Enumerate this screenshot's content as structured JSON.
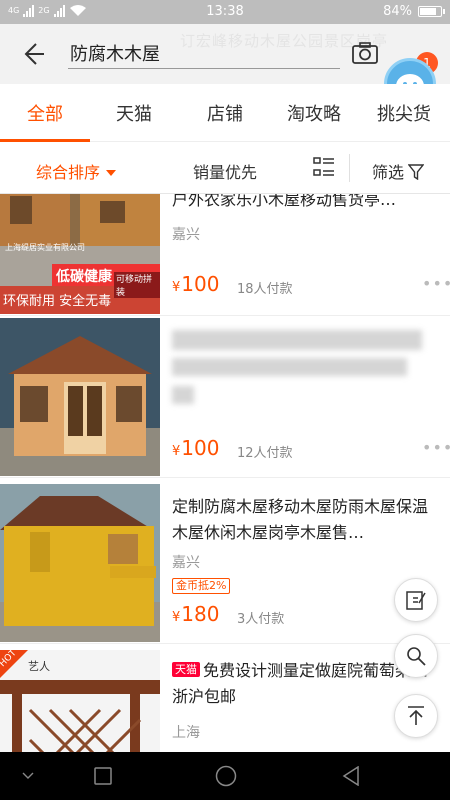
{
  "status_bar": {
    "network": "4G",
    "network2": "2G",
    "time": "13:38",
    "battery": "84%",
    "battery_level": 0.84
  },
  "search": {
    "query": "防腐木木屋",
    "background_hint": "订宏峰移动木屋公园景区岗亭",
    "notification_count": "1"
  },
  "tabs": [
    {
      "label": "全部",
      "active": true
    },
    {
      "label": "天猫"
    },
    {
      "label": "店铺"
    },
    {
      "label": "淘攻略"
    },
    {
      "label": "挑尖货"
    }
  ],
  "sort": {
    "comprehensive": "综合排序",
    "sales": "销量优先",
    "filter": "筛选"
  },
  "items": [
    {
      "title": "户外农家乐小木屋移动售货亭…",
      "location": "嘉兴",
      "currency": "¥",
      "price": "100",
      "sales": "18人付款",
      "img_text_1": "低碳健康",
      "img_text_2": "环保耐用 安全无毒",
      "img_text_3": "可移动拼装",
      "img_text_4": "上海缇居实业有限公司"
    },
    {
      "title": "",
      "location": "",
      "currency": "¥",
      "price": "100",
      "sales": "12人付款"
    },
    {
      "title": "定制防腐木屋移动木屋防雨木屋保温木屋休闲木屋岗亭木屋售…",
      "location": "嘉兴",
      "coupon": "金币抵2%",
      "currency": "¥",
      "price": "180",
      "sales": "3人付款"
    },
    {
      "tmall_badge": "天猫",
      "title": "免费设计测量定做庭院葡萄架江浙沪包邮",
      "location": "上海",
      "hot": "HOT",
      "brand": "艺人"
    }
  ],
  "icons": {
    "back": "back-arrow-icon",
    "camera": "camera-icon",
    "more": "more-vert-icon",
    "layout": "list-layout-icon",
    "filter": "filter-funnel-icon",
    "edit": "edit-icon",
    "search_float": "search-float-icon",
    "top": "back-to-top-icon"
  },
  "colors": {
    "accent": "#ff5000",
    "tmall": "#ff0036"
  }
}
